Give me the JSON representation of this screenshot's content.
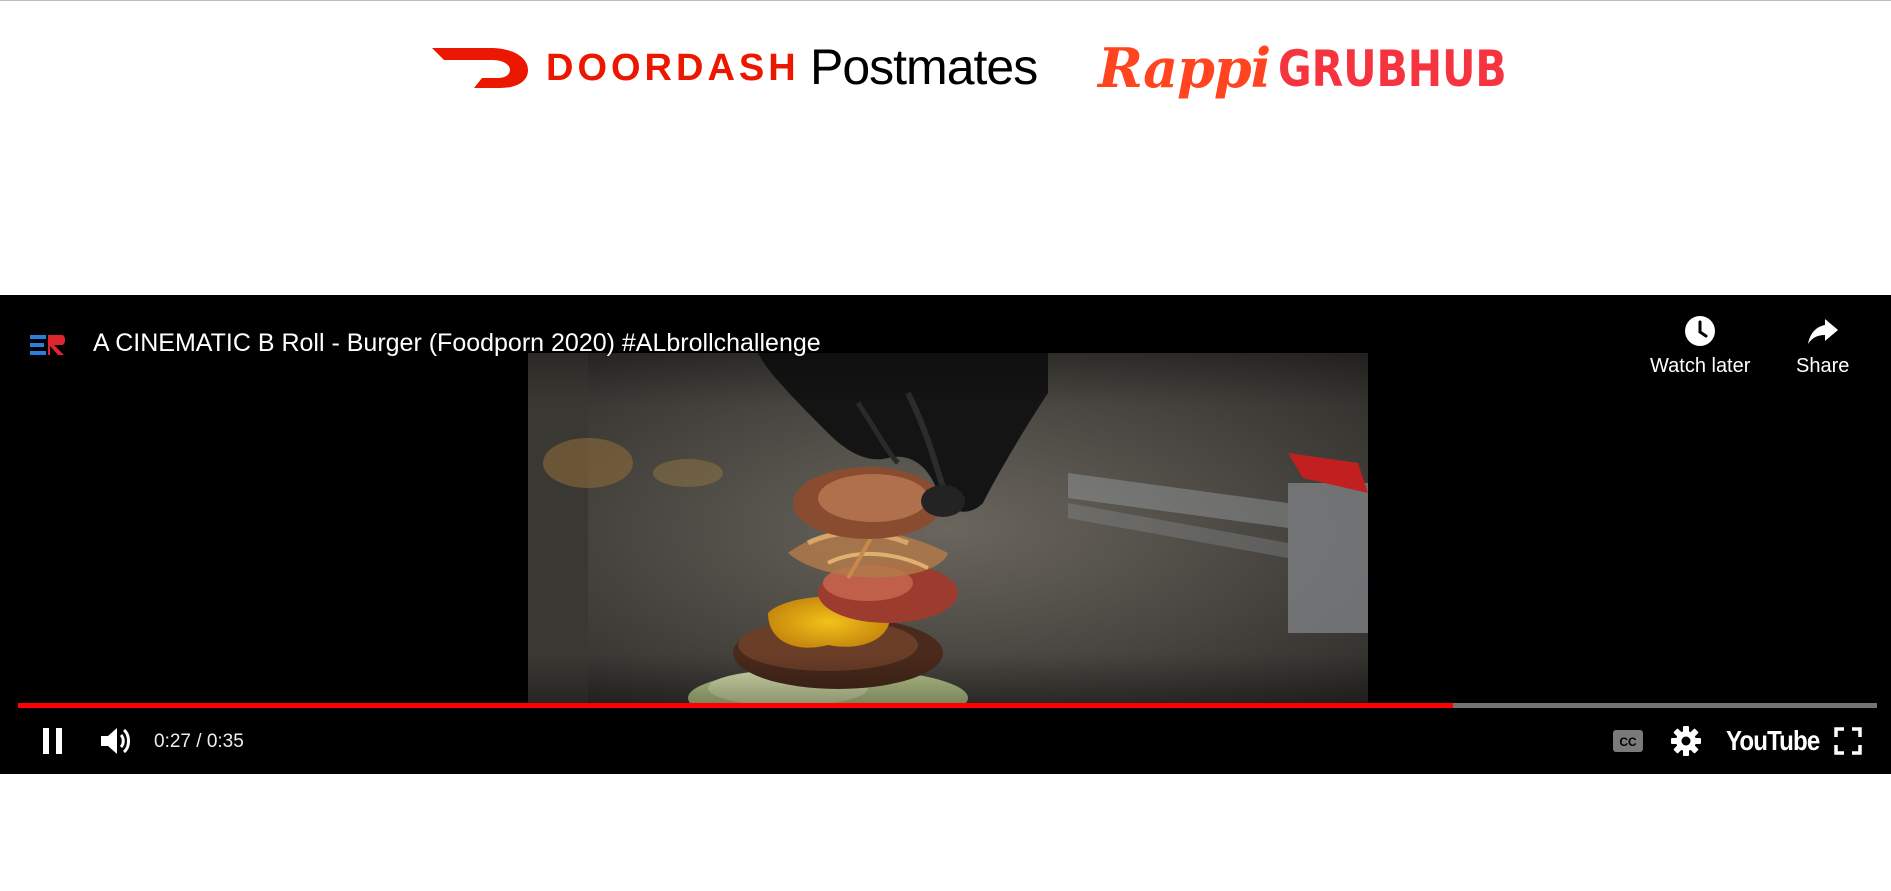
{
  "partners": {
    "doordash": {
      "label": "DOORDASH",
      "color": "#eb1700"
    },
    "postmates": {
      "label": "Postmates",
      "color": "#000000"
    },
    "rappi": {
      "label": "Rappi",
      "color": "#ff441f"
    },
    "grubhub": {
      "label": "GRUBHUB",
      "color": "#f63440"
    }
  },
  "player": {
    "title": "A CINEMATIC B Roll - Burger (Foodporn 2020) #ALbrollchallenge",
    "channel_icon": "channel-logo-icon",
    "watch_later_label": "Watch later",
    "share_label": "Share",
    "time_display": "0:27 / 0:35",
    "current_time": "0:27",
    "duration": "0:35",
    "progress_played": 0.772,
    "progress_loaded": 0.772,
    "youtube_label": "YouTube",
    "state": "playing",
    "icons": [
      "pause-icon",
      "volume-icon",
      "captions-icon",
      "settings-icon",
      "fullscreen-icon",
      "clock-icon",
      "share-arrow-icon"
    ],
    "accent_color": "#ff0000"
  }
}
